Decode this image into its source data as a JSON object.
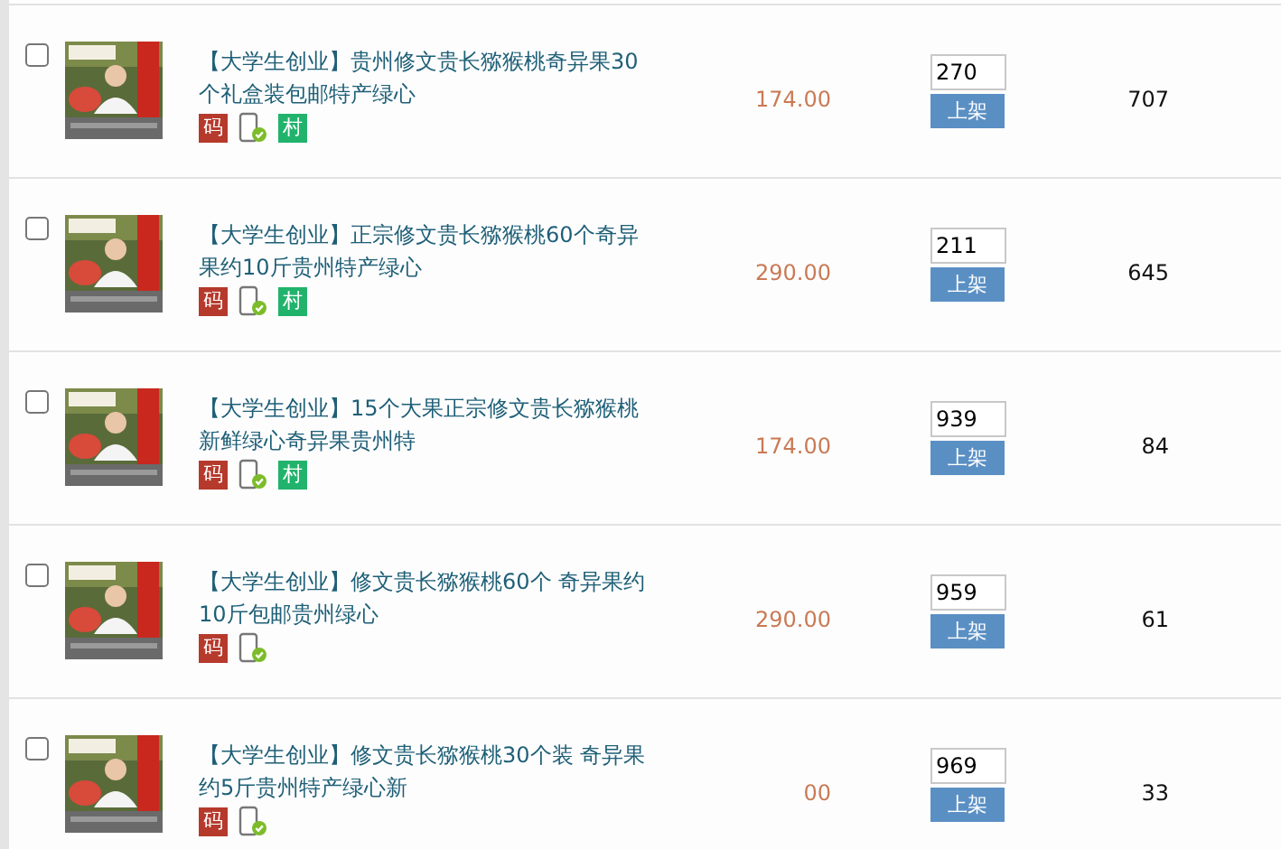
{
  "products": [
    {
      "checked": false,
      "title": "【大学生创业】贵州修文贵长猕猴桃奇异果30个礼盒装包邮特产绿心",
      "badges": [
        {
          "kind": "code",
          "text": "码"
        },
        {
          "kind": "mobile"
        },
        {
          "kind": "village",
          "text": "村"
        }
      ],
      "price": "174.00",
      "stock": "270",
      "button": "上架",
      "sales": "707"
    },
    {
      "checked": false,
      "title": "【大学生创业】正宗修文贵长猕猴桃60个奇异果约10斤贵州特产绿心",
      "badges": [
        {
          "kind": "code",
          "text": "码"
        },
        {
          "kind": "mobile"
        },
        {
          "kind": "village",
          "text": "村"
        }
      ],
      "price": "290.00",
      "stock": "211",
      "button": "上架",
      "sales": "645"
    },
    {
      "checked": false,
      "title": "【大学生创业】15个大果正宗修文贵长猕猴桃新鲜绿心奇异果贵州特",
      "badges": [
        {
          "kind": "code",
          "text": "码"
        },
        {
          "kind": "mobile"
        },
        {
          "kind": "village",
          "text": "村"
        }
      ],
      "price": "174.00",
      "stock": "939",
      "button": "上架",
      "sales": "84"
    },
    {
      "checked": false,
      "title": "【大学生创业】修文贵长猕猴桃60个 奇异果约10斤包邮贵州绿心",
      "badges": [
        {
          "kind": "code",
          "text": "码"
        },
        {
          "kind": "mobile"
        }
      ],
      "price": "290.00",
      "stock": "959",
      "button": "上架",
      "sales": "61"
    },
    {
      "checked": false,
      "title": "【大学生创业】修文贵长猕猴桃30个装 奇异果约5斤贵州特产绿心新",
      "badges": [
        {
          "kind": "code",
          "text": "码"
        },
        {
          "kind": "mobile"
        }
      ],
      "price": "00",
      "stock": "969",
      "button": "上架",
      "sales": "33"
    }
  ]
}
